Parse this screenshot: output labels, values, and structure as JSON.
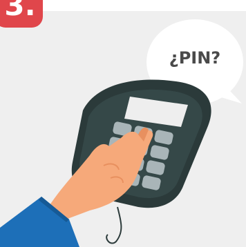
{
  "step": {
    "label": "3."
  },
  "bubble": {
    "text": "¿PIN?"
  },
  "colors": {
    "badge": "#e0464b",
    "background": "#efefef",
    "terminal": "#2b3a3a",
    "keys": "#a9b5b8",
    "hand": "#f6a97a",
    "sleeve": "#1d6fb8"
  },
  "icons": {
    "terminal": "payment-terminal-icon",
    "hand": "hand-pressing-icon",
    "bubble": "speech-bubble-icon"
  }
}
